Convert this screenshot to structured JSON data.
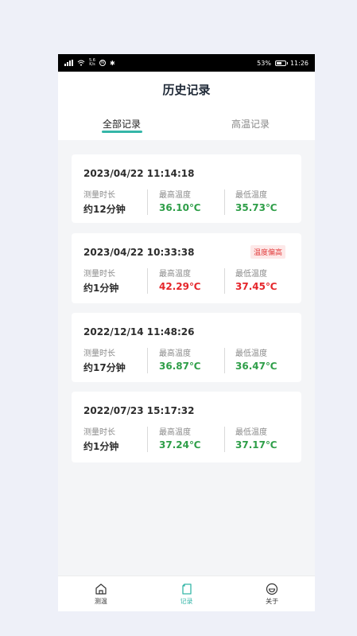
{
  "status_bar": {
    "net_speed_value": "5.6",
    "net_speed_unit": "K/s",
    "battery": "53%",
    "time": "11:26"
  },
  "header": {
    "title": "历史记录",
    "tabs": [
      {
        "label": "全部记录",
        "active": true
      },
      {
        "label": "高温记录",
        "active": false
      }
    ]
  },
  "labels": {
    "duration": "测量时长",
    "max_temp": "最高温度",
    "min_temp": "最低温度"
  },
  "records": [
    {
      "datetime": "2023/04/22 11:14:18",
      "duration": "约12分钟",
      "max": "36.10℃",
      "min": "35.73℃",
      "badge": ""
    },
    {
      "datetime": "2023/04/22 10:33:38",
      "duration": "约1分钟",
      "max": "42.29℃",
      "min": "37.45℃",
      "badge": "温度偏高"
    },
    {
      "datetime": "2022/12/14 11:48:26",
      "duration": "约17分钟",
      "max": "36.87℃",
      "min": "36.47℃",
      "badge": ""
    },
    {
      "datetime": "2022/07/23 15:17:32",
      "duration": "约1分钟",
      "max": "37.24℃",
      "min": "37.17℃",
      "badge": ""
    }
  ],
  "colors": {
    "accent": "#35b6a8",
    "normal_temp": "#2e9e48",
    "high_temp": "#e5252a"
  },
  "bottom_nav": [
    {
      "label": "测温",
      "icon": "home-icon",
      "active": false
    },
    {
      "label": "记录",
      "icon": "record-icon",
      "active": true
    },
    {
      "label": "关于",
      "icon": "smile-icon",
      "active": false
    }
  ]
}
